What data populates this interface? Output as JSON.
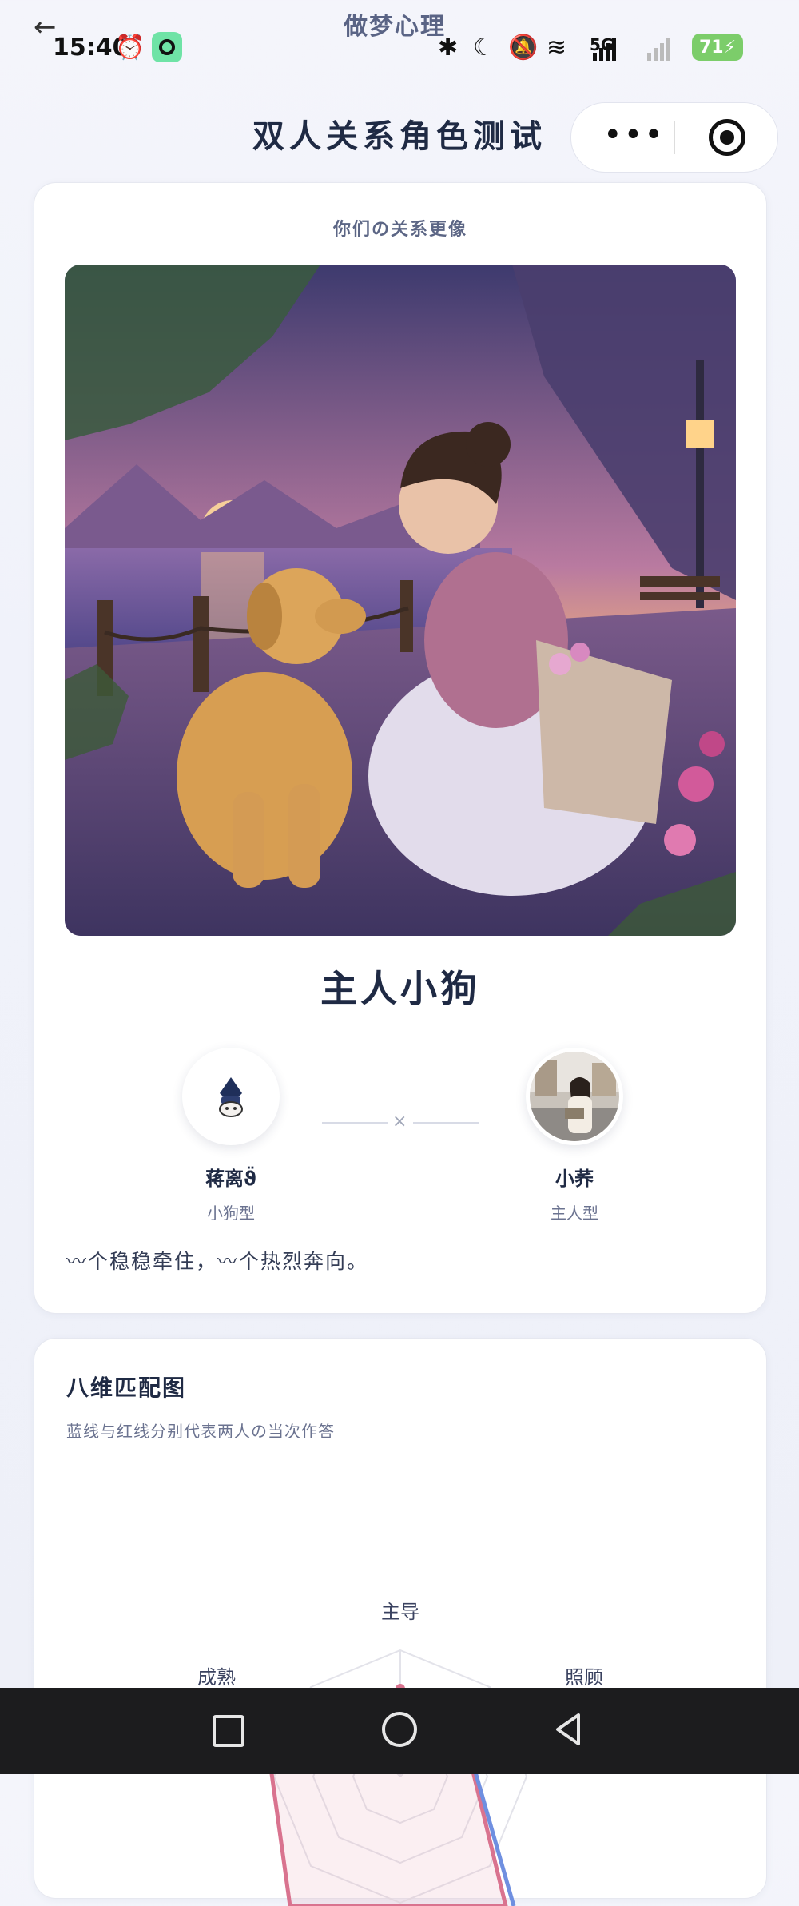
{
  "status": {
    "back": "←",
    "app_name": "做梦心理",
    "time": "15:40",
    "network": "5G",
    "battery": "71"
  },
  "header": {
    "title": "双人关系角色测试"
  },
  "result_card": {
    "subtitle": "你们の关系更像",
    "result_title": "主人小狗",
    "person_a": {
      "name": "蒋离ϑ̈",
      "type": "小狗型"
    },
    "connector": "×",
    "person_b": {
      "name": "小荞",
      "type": "主人型"
    },
    "quote": "〰个稳稳牵住，〰个热烈奔向。"
  },
  "radar_card": {
    "title": "八维匹配图",
    "subtitle": "蓝线与红线分别代表两人の当次作答",
    "axis_labels": [
      "主导",
      "照顾",
      "成熟"
    ]
  },
  "colors": {
    "red_series": "#d9738f",
    "blue_series": "#6f8fe0",
    "title": "#1f2a44"
  }
}
